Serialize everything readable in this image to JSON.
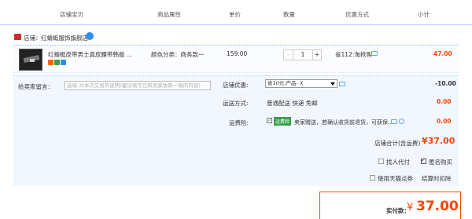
{
  "header": {
    "col_shop_item": "店铺宝贝",
    "col_attr": "商品属性",
    "col_price": "单价",
    "col_qty": "数量",
    "col_promo": "优惠方式",
    "col_subtotal": "小计"
  },
  "shop": {
    "prefix": "店铺：",
    "name": "红蜻蜓服饰旗舰店"
  },
  "item": {
    "title": "红蜻蜓皮带男士真皮腰带韩版 ...",
    "attr": "颜色分类：商务款一",
    "price": "159.00",
    "qty_minus": "-",
    "qty_value": "1",
    "qty_plus": "+",
    "promo": "省112:淘抢购",
    "subtotal": "47.00"
  },
  "message": {
    "label": "给卖家留言：",
    "placeholder": "选填:对本次交易的说明(建议填写已和卖家协商一致的内容)"
  },
  "shop_discount": {
    "label": "店铺优惠:",
    "selected": "省10元:产品- X",
    "value": "-10.00"
  },
  "shipping": {
    "label": "运送方式:",
    "method": "普通配送 快递 免邮",
    "value": "0.00"
  },
  "insurance": {
    "label": "运费险:",
    "badge": "运费险",
    "text": "卖家赠送，若确认收货前退货，可获保...",
    "value": "0.00"
  },
  "shop_total": {
    "label": "店铺合计(含运费)",
    "value": "¥37.00"
  },
  "options": {
    "proxy_pay": "找人代付",
    "anonymous": "匿名购买",
    "use_points": "使用天猫点券",
    "settle_rules": "结算时扣除"
  },
  "actual_pay": {
    "label": "实付款：",
    "currency": "¥",
    "value": "37.00"
  },
  "colors": {
    "accent": "#ff4401",
    "border_blue": "#b2d1ff",
    "panel_bg": "#f2f7ff",
    "insurance_green": "#36a04a"
  }
}
